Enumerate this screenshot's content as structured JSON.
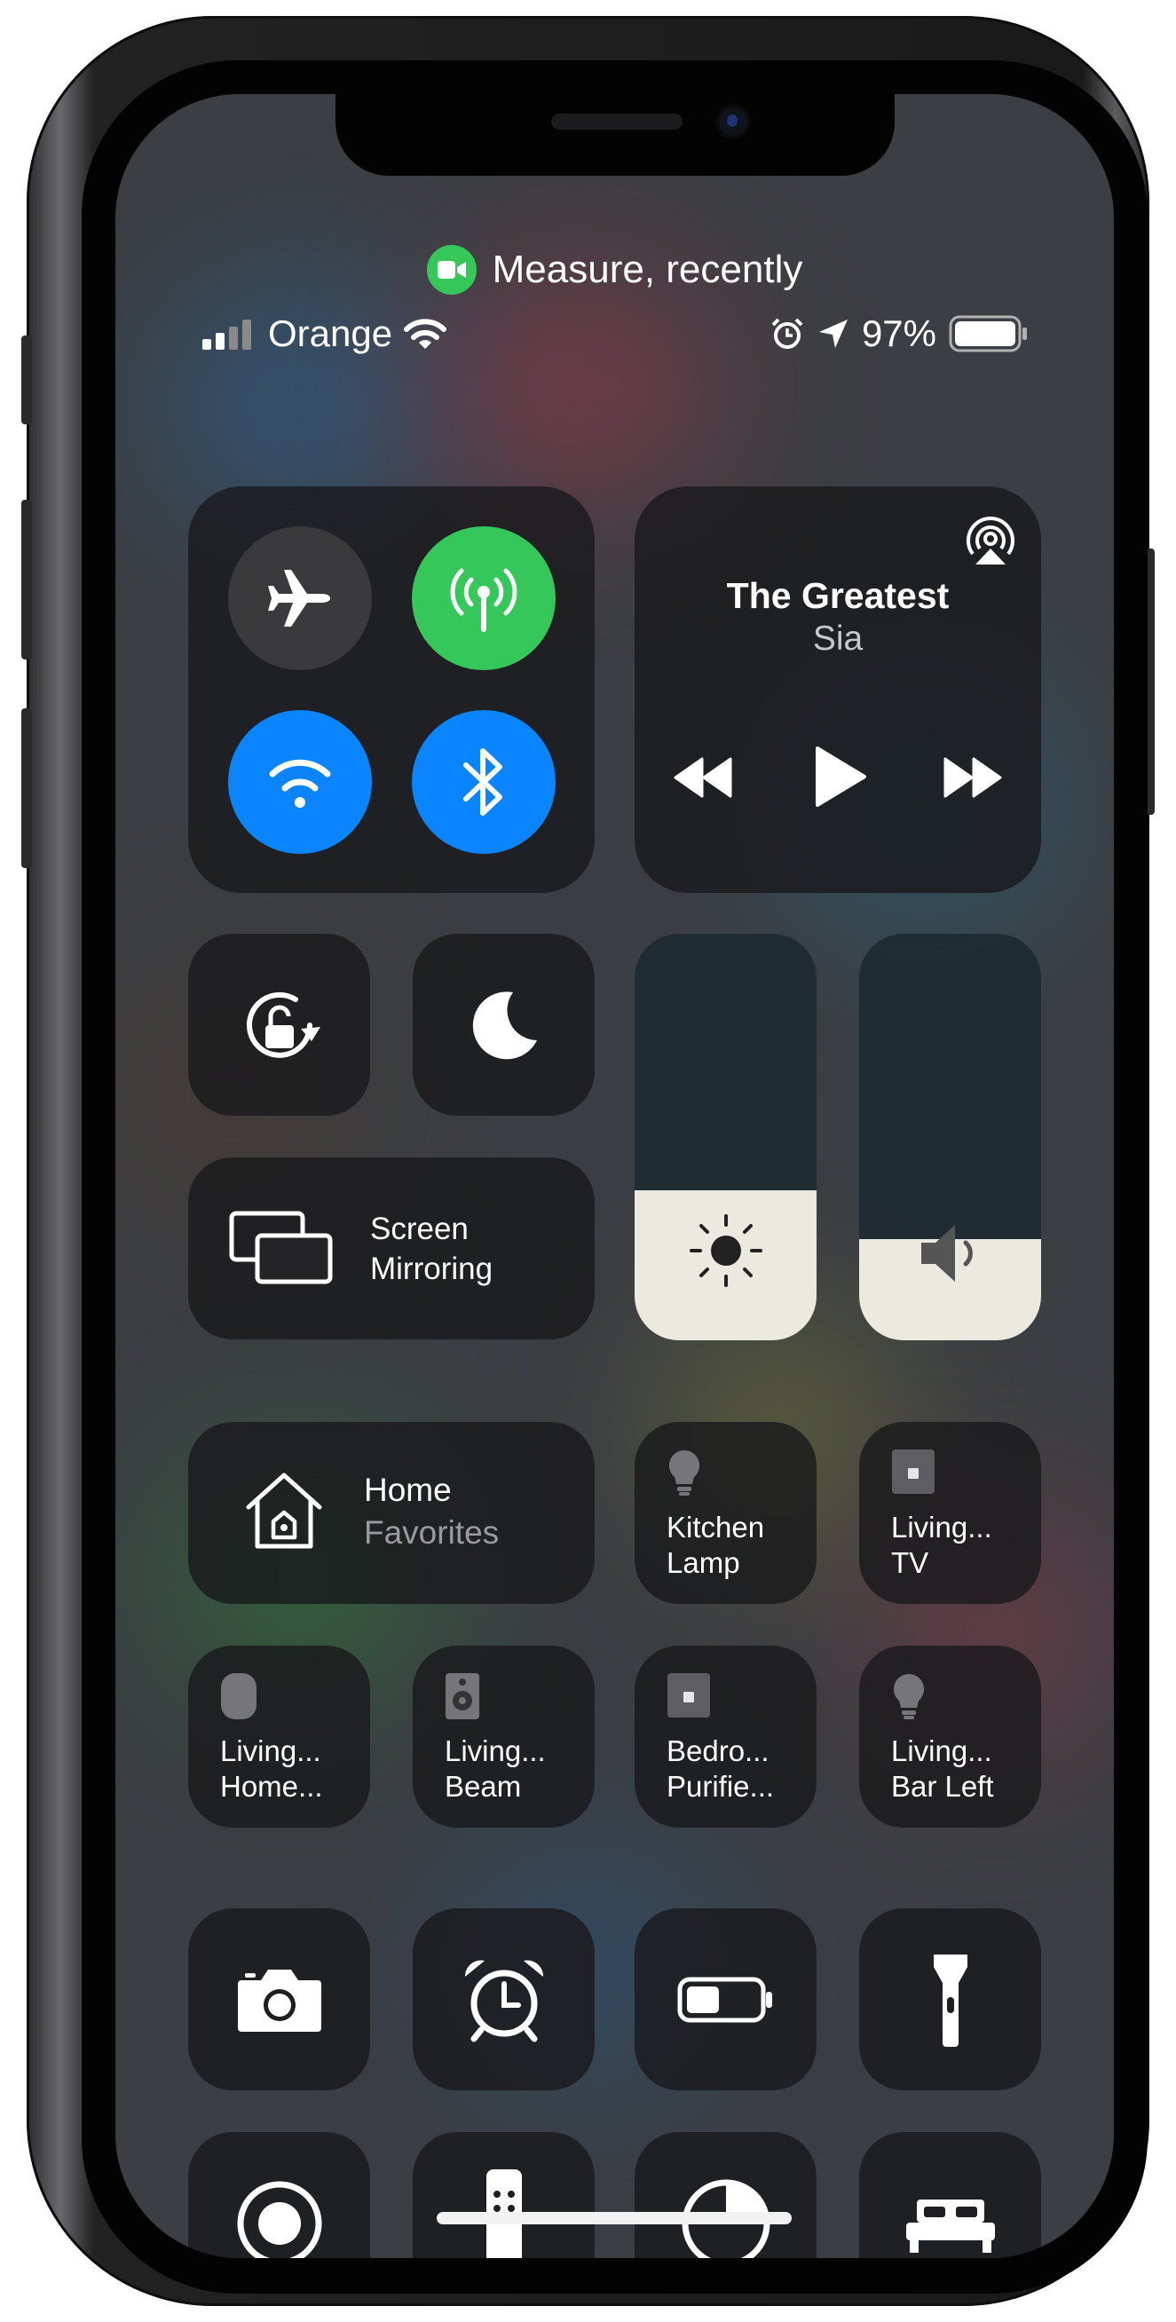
{
  "call_indicator": {
    "text": "Measure, recently",
    "color": "#35c759"
  },
  "status_bar": {
    "carrier": "Orange",
    "battery": "97%",
    "signal_bars": 2,
    "icons": [
      "wifi-icon",
      "alarm-icon",
      "location-arrow-icon",
      "battery-icon"
    ]
  },
  "connectivity": [
    {
      "name": "airplane-mode",
      "state": "off",
      "color": "#3a3a3c"
    },
    {
      "name": "cellular-data",
      "state": "on",
      "color": "#35c759"
    },
    {
      "name": "wifi",
      "state": "on",
      "color": "#0a84ff"
    },
    {
      "name": "bluetooth",
      "state": "on",
      "color": "#0a84ff"
    }
  ],
  "now_playing": {
    "title": "The Greatest",
    "artist": "Sia",
    "controls": [
      "rewind-icon",
      "play-icon",
      "fast-forward-icon"
    ]
  },
  "quick_toggles": [
    {
      "name": "orientation-lock",
      "icon": "lock-rotation-icon"
    },
    {
      "name": "do-not-disturb",
      "icon": "moon-icon"
    }
  ],
  "screen_mirroring": {
    "line1": "Screen",
    "line2": "Mirroring"
  },
  "sliders": {
    "brightness_level": 0.37,
    "volume_level": 0.25
  },
  "home": {
    "title": "Home",
    "subtitle": "Favorites"
  },
  "home_accessories": [
    {
      "line1": "Kitchen",
      "line2": "Lamp",
      "icon": "lightbulb-icon"
    },
    {
      "line1": "Living...",
      "line2": "TV",
      "icon": "outlet-icon"
    },
    {
      "line1": "Living...",
      "line2": "Home...",
      "icon": "homepod-icon"
    },
    {
      "line1": "Living...",
      "line2": "Beam",
      "icon": "speaker-icon"
    },
    {
      "line1": "Bedro...",
      "line2": "Purifie...",
      "icon": "outlet-icon"
    },
    {
      "line1": "Living...",
      "line2": "Bar Left",
      "icon": "lightbulb-icon"
    }
  ],
  "controls_row1": [
    "camera-icon",
    "alarm-clock-icon",
    "low-power-icon",
    "flashlight-icon"
  ],
  "controls_row2": [
    "screen-record-icon",
    "apple-tv-remote-icon",
    "accessibility-icon",
    "sleep-bed-icon"
  ]
}
